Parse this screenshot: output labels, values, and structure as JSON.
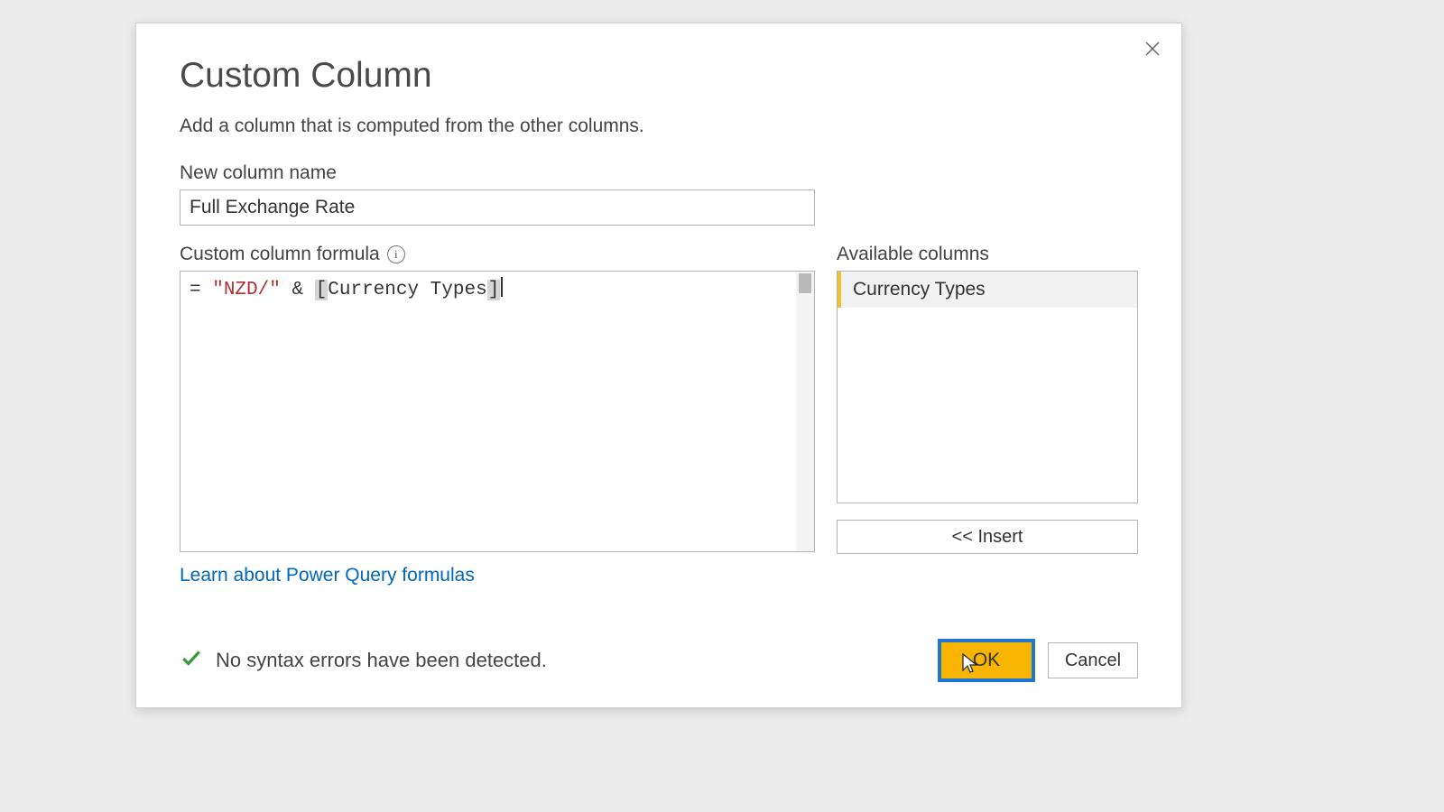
{
  "dialog": {
    "title": "Custom Column",
    "subtitle": "Add a column that is computed from the other columns.",
    "name_label": "New column name",
    "name_value": "Full Exchange Rate",
    "formula_label": "Custom column formula",
    "formula_value": "= \"NZD/\" & [Currency Types]",
    "formula_tokens": {
      "eq": "= ",
      "string": "\"NZD/\"",
      "amp": " & ",
      "lbracket": "[",
      "colref": "Currency Types",
      "rbracket": "]"
    },
    "available_label": "Available columns",
    "available_items": [
      "Currency Types"
    ],
    "insert_label": "<< Insert",
    "learn_link": "Learn about Power Query formulas",
    "status_text": "No syntax errors have been detected.",
    "ok_label": "OK",
    "cancel_label": "Cancel"
  }
}
